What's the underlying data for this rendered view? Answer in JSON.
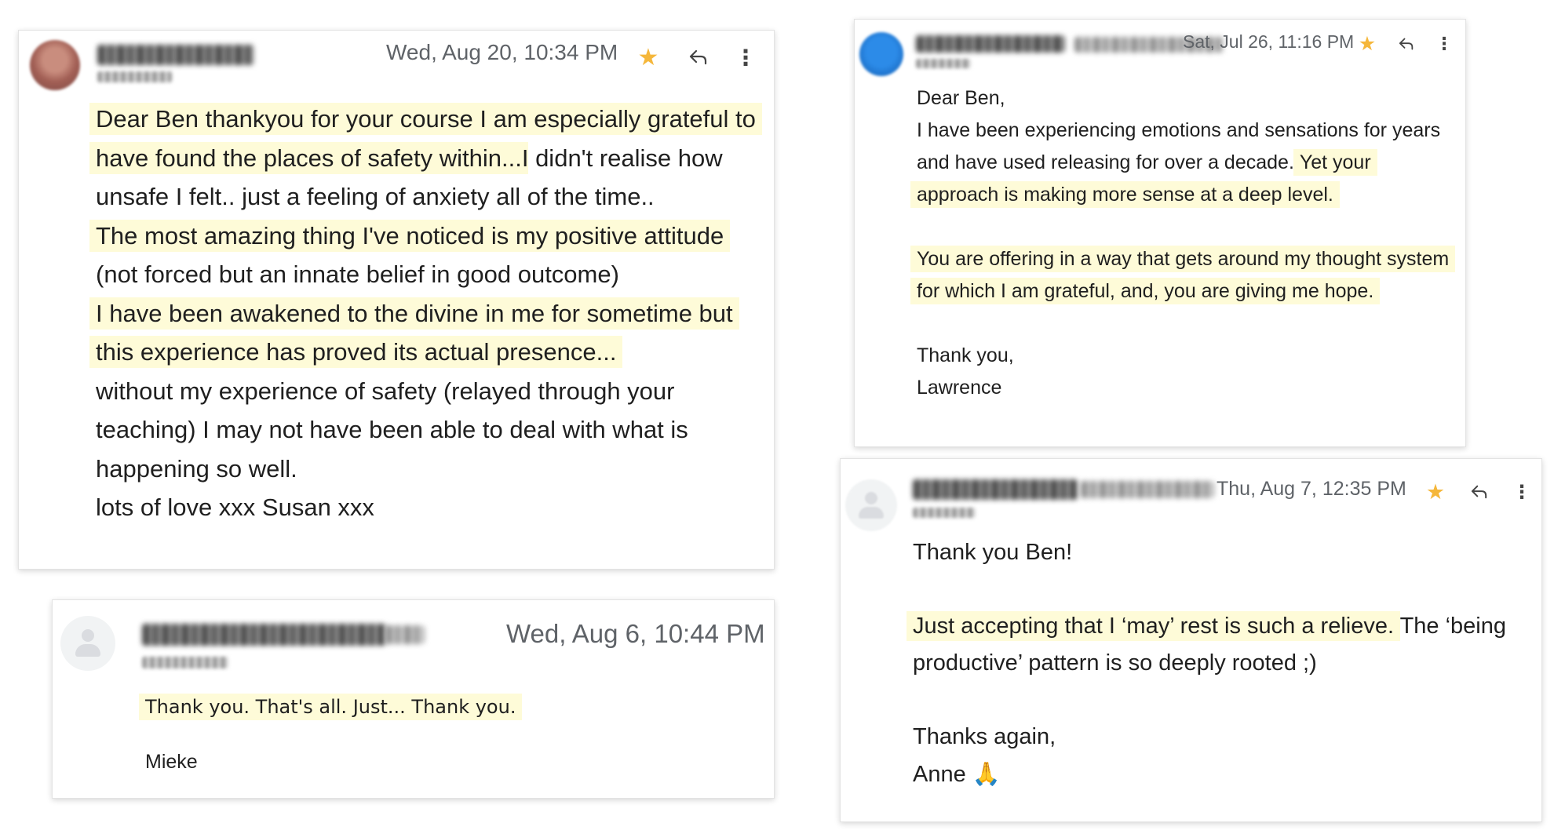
{
  "emails": [
    {
      "id": "susan",
      "date": "Wed, Aug 20, 10:34 PM",
      "icons": {
        "star": "star-icon",
        "reply": "reply-icon",
        "more": "more-vert-icon"
      },
      "segments": [
        {
          "text": "Dear Ben thankyou for your course I am especially grateful to have found the places of safety within...",
          "highlight": true
        },
        {
          "text": "I didn't realise how unsafe I felt.. just a feeling of anxiety all of the time..",
          "highlight": false
        },
        {
          "text": "The most amazing thing I've noticed is my positive attitude",
          "highlight": true
        },
        {
          "text": " (not forced but an innate belief in good outcome)",
          "highlight": false
        },
        {
          "text": "I have been awakened to the divine in me for sometime but this experience has proved its actual presence...",
          "highlight": true
        },
        {
          "text": "without my experience of safety (relayed through your teaching) I may not have been able to deal with what is happening so well.",
          "highlight": false
        },
        {
          "text": "lots of love xxx Susan xxx",
          "highlight": false
        }
      ]
    },
    {
      "id": "lawrence",
      "date": "Sat, Jul 26, 11:16 PM",
      "icons": {
        "star": "star-icon",
        "reply": "reply-icon",
        "more": "more-vert-icon"
      },
      "greeting": "Dear Ben,",
      "para1_plain": "I have been experiencing emotions and sensations for years and have used releasing for over a decade. ",
      "para1_highlight": "Yet your approach is making more sense at a deep level.",
      "para2_highlight": "You are offering in a way that gets around my thought system for which I am grateful, and, you are giving me hope.",
      "closing": "Thank you,",
      "signature": "Lawrence"
    },
    {
      "id": "mieke",
      "date": "Wed, Aug 6, 10:44 PM",
      "body_highlight": "Thank you. That's all. Just... Thank you.",
      "signature": "Mieke"
    },
    {
      "id": "anne",
      "date": "Thu, Aug 7, 12:35 PM",
      "icons": {
        "star": "star-icon",
        "reply": "reply-icon",
        "more": "more-vert-icon"
      },
      "greeting": "Thank you Ben!",
      "para_highlight": "Just accepting that I ‘may’ rest is such a relieve.",
      "para_plain": " The ‘being productive’ pattern is so deeply rooted ;)",
      "closing": "Thanks again,",
      "signature": "Anne",
      "signature_emoji": "🙏"
    }
  ],
  "colors": {
    "highlight": "#fefbd8",
    "star": "#f5b73b",
    "meta": "#5f6368"
  }
}
